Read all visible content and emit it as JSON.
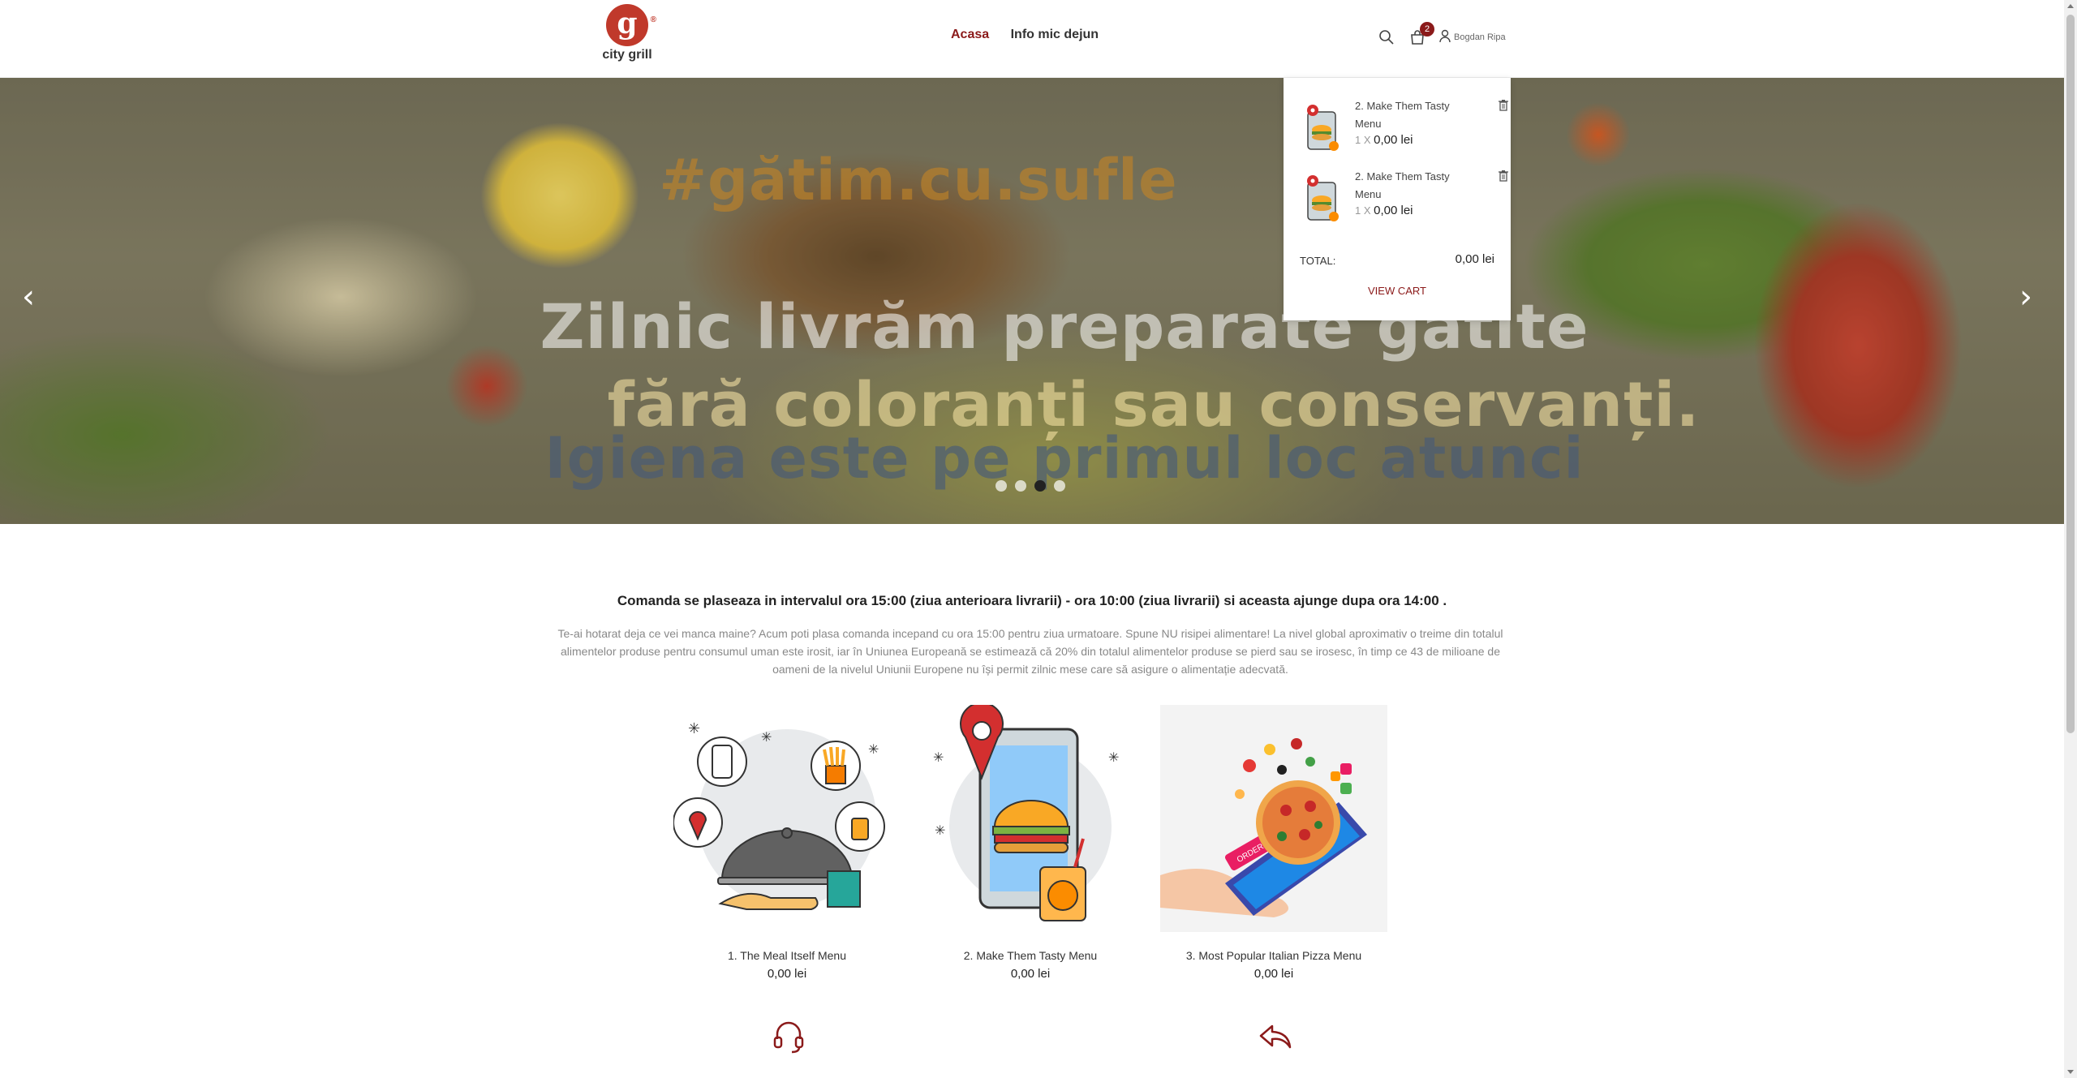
{
  "header": {
    "logo_letter": "g",
    "logo_text": "city grill",
    "nav": [
      {
        "label": "Acasa",
        "active": true
      },
      {
        "label": "Info mic dejun",
        "active": false
      }
    ],
    "cart_count": "2",
    "user_name": "Bogdan Ripa",
    "icons": [
      "search-icon",
      "cart-icon",
      "user-icon"
    ]
  },
  "hero": {
    "lines": [
      "#gătim.cu.sufle",
      "Zilnic livrăm preparate gătite",
      "fără coloranți sau conservanți.",
      "Igiena este pe primul loc atunci"
    ],
    "prev_icon": "chevron-left-icon",
    "next_icon": "chevron-right-icon",
    "active_slide": 3,
    "slide_count": 4
  },
  "cart_dropdown": {
    "items": [
      {
        "name": "2. Make Them Tasty Menu",
        "qty": "1 X",
        "price": "0,00 lei"
      },
      {
        "name": "2. Make Them Tasty Menu",
        "qty": "1 X",
        "price": "0,00 lei"
      }
    ],
    "total_label": "TOTAL:",
    "total_value": "0,00 lei",
    "view_cart": "VIEW CART"
  },
  "info": {
    "title": "Comanda se plaseaza in intervalul ora 15:00 (ziua anterioara livrarii) - ora 10:00 (ziua livrarii) si aceasta ajunge dupa ora 14:00 .",
    "description": "Te-ai hotarat deja ce vei manca maine? Acum poti plasa comanda incepand cu ora 15:00 pentru ziua urmatoare. Spune NU risipei alimentare! La nivel global aproximativ o treime din totalul alimentelor produse pentru consumul uman este irosit, iar în Uniunea Europeană se estimează că 20% din totalul alimentelor produse se pierd sau se irosesc, în timp ce 43 de milioane de oameni de la nivelul Uniunii Europene nu își permit zilnic mese care să asigure o alimentație adecvată."
  },
  "products": [
    {
      "name": "1. The Meal Itself Menu",
      "price": "0,00 lei"
    },
    {
      "name": "2. Make Them Tasty Menu",
      "price": "0,00 lei"
    },
    {
      "name": "3. Most Popular Italian Pizza Menu",
      "price": "0,00 lei"
    }
  ],
  "pizza_screen_text": "ORDER",
  "features": [
    "headset-icon",
    "reply-arrow-icon"
  ],
  "colors": {
    "accent": "#8b1a1a",
    "logo_red": "#c0392b"
  }
}
